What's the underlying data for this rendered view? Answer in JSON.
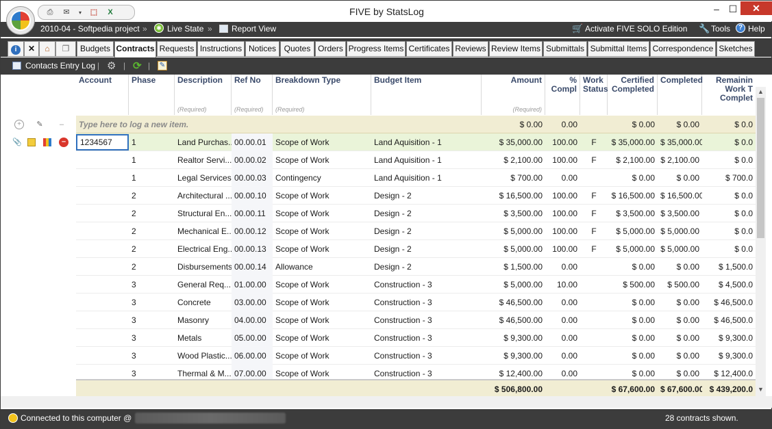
{
  "window": {
    "title": "FIVE by StatsLog",
    "minimize": "–",
    "maximize": "☐",
    "close": "✕"
  },
  "quick_access": [
    "printer-icon",
    "email-icon",
    "dropdown-icon",
    "pdf-icon",
    "excel-icon"
  ],
  "menu": {
    "project": "2010-04 - Softpedia project",
    "sep": "»",
    "live_state": "Live State",
    "report_view": "Report View",
    "activate": "Activate FIVE SOLO Edition",
    "tools": "Tools",
    "help": "Help"
  },
  "tabs": [
    "Budgets",
    "Contracts",
    "Requests",
    "Instructions",
    "Notices",
    "Quotes",
    "Orders",
    "Progress Items",
    "Certificates",
    "Reviews",
    "Review Items",
    "Submittals",
    "Submittal Items",
    "Correspondence",
    "Sketches"
  ],
  "active_tab": "Contracts",
  "toolbar": {
    "contacts_label": "Contacts Entry Log",
    "sep": "|"
  },
  "columns": {
    "account": "Account",
    "phase": "Phase",
    "description": "Description",
    "ref_no": "Ref No",
    "breakdown": "Breakdown Type",
    "budget_item": "Budget Item",
    "amount": "Amount",
    "pct_l1": "%",
    "pct_l2": "Compl",
    "work_l1": "Work",
    "work_l2": "Status",
    "cert_l1": "Certified",
    "cert_l2": "Completed",
    "completed": "Completed",
    "rem_l1": "Remainin",
    "rem_l2": "Work T",
    "rem_l3": "Complet",
    "required": "(Required)"
  },
  "new_row": {
    "placeholder": "Type here to log a new item.",
    "amount": "$ 0.00",
    "pct": "0.00",
    "certified": "$ 0.00",
    "completed": "$ 0.00",
    "remaining": "$ 0.0"
  },
  "rows": [
    {
      "account": "1234567",
      "phase": "1",
      "description": "Land Purchas...",
      "ref": "00.00.01",
      "breakdown": "Scope of Work",
      "budget": "Land Aquisition - 1",
      "amount": "$ 35,000.00",
      "pct": "100.00",
      "status": "F",
      "certified": "$ 35,000.00",
      "completed": "$ 35,000.00",
      "remaining": "$ 0.0"
    },
    {
      "account": "",
      "phase": "1",
      "description": "Realtor Servi...",
      "ref": "00.00.02",
      "breakdown": "Scope of Work",
      "budget": "Land Aquisition - 1",
      "amount": "$ 2,100.00",
      "pct": "100.00",
      "status": "F",
      "certified": "$ 2,100.00",
      "completed": "$ 2,100.00",
      "remaining": "$ 0.0"
    },
    {
      "account": "",
      "phase": "1",
      "description": "Legal Services",
      "ref": "00.00.03",
      "breakdown": "Contingency",
      "budget": "Land Aquisition - 1",
      "amount": "$ 700.00",
      "pct": "0.00",
      "status": "",
      "certified": "$ 0.00",
      "completed": "$ 0.00",
      "remaining": "$ 700.0"
    },
    {
      "account": "",
      "phase": "2",
      "description": "Architectural ...",
      "ref": "00.00.10",
      "breakdown": "Scope of Work",
      "budget": "Design - 2",
      "amount": "$ 16,500.00",
      "pct": "100.00",
      "status": "F",
      "certified": "$ 16,500.00",
      "completed": "$ 16,500.00",
      "remaining": "$ 0.0"
    },
    {
      "account": "",
      "phase": "2",
      "description": "Structural En...",
      "ref": "00.00.11",
      "breakdown": "Scope of Work",
      "budget": "Design - 2",
      "amount": "$ 3,500.00",
      "pct": "100.00",
      "status": "F",
      "certified": "$ 3,500.00",
      "completed": "$ 3,500.00",
      "remaining": "$ 0.0"
    },
    {
      "account": "",
      "phase": "2",
      "description": "Mechanical E...",
      "ref": "00.00.12",
      "breakdown": "Scope of Work",
      "budget": "Design - 2",
      "amount": "$ 5,000.00",
      "pct": "100.00",
      "status": "F",
      "certified": "$ 5,000.00",
      "completed": "$ 5,000.00",
      "remaining": "$ 0.0"
    },
    {
      "account": "",
      "phase": "2",
      "description": "Electrical Eng...",
      "ref": "00.00.13",
      "breakdown": "Scope of Work",
      "budget": "Design - 2",
      "amount": "$ 5,000.00",
      "pct": "100.00",
      "status": "F",
      "certified": "$ 5,000.00",
      "completed": "$ 5,000.00",
      "remaining": "$ 0.0"
    },
    {
      "account": "",
      "phase": "2",
      "description": "Disbursements",
      "ref": "00.00.14",
      "breakdown": "Allowance",
      "budget": "Design - 2",
      "amount": "$ 1,500.00",
      "pct": "0.00",
      "status": "",
      "certified": "$ 0.00",
      "completed": "$ 0.00",
      "remaining": "$ 1,500.0"
    },
    {
      "account": "",
      "phase": "3",
      "description": "General Req...",
      "ref": "01.00.00",
      "breakdown": "Scope of Work",
      "budget": "Construction - 3",
      "amount": "$ 5,000.00",
      "pct": "10.00",
      "status": "",
      "certified": "$ 500.00",
      "completed": "$ 500.00",
      "remaining": "$ 4,500.0"
    },
    {
      "account": "",
      "phase": "3",
      "description": "Concrete",
      "ref": "03.00.00",
      "breakdown": "Scope of Work",
      "budget": "Construction - 3",
      "amount": "$ 46,500.00",
      "pct": "0.00",
      "status": "",
      "certified": "$ 0.00",
      "completed": "$ 0.00",
      "remaining": "$ 46,500.0"
    },
    {
      "account": "",
      "phase": "3",
      "description": "Masonry",
      "ref": "04.00.00",
      "breakdown": "Scope of Work",
      "budget": "Construction - 3",
      "amount": "$ 46,500.00",
      "pct": "0.00",
      "status": "",
      "certified": "$ 0.00",
      "completed": "$ 0.00",
      "remaining": "$ 46,500.0"
    },
    {
      "account": "",
      "phase": "3",
      "description": "Metals",
      "ref": "05.00.00",
      "breakdown": "Scope of Work",
      "budget": "Construction - 3",
      "amount": "$ 9,300.00",
      "pct": "0.00",
      "status": "",
      "certified": "$ 0.00",
      "completed": "$ 0.00",
      "remaining": "$ 9,300.0"
    },
    {
      "account": "",
      "phase": "3",
      "description": "Wood Plastic...",
      "ref": "06.00.00",
      "breakdown": "Scope of Work",
      "budget": "Construction - 3",
      "amount": "$ 9,300.00",
      "pct": "0.00",
      "status": "",
      "certified": "$ 0.00",
      "completed": "$ 0.00",
      "remaining": "$ 9,300.0"
    },
    {
      "account": "",
      "phase": "3",
      "description": "Thermal & M...",
      "ref": "07.00.00",
      "breakdown": "Scope of Work",
      "budget": "Construction - 3",
      "amount": "$ 12,400.00",
      "pct": "0.00",
      "status": "",
      "certified": "$ 0.00",
      "completed": "$ 0.00",
      "remaining": "$ 12,400.0"
    }
  ],
  "totals": {
    "amount": "$ 506,800.00",
    "certified": "$ 67,600.00",
    "completed": "$ 67,600.00",
    "remaining": "$ 439,200.0"
  },
  "status": {
    "connection": "Connected to this computer @",
    "count": "28 contracts shown."
  },
  "colors": {
    "dark_bar": "#3c3c3c",
    "new_row_bg": "#f1edd3",
    "selected_row_bg": "#eaf4d9",
    "totals_bg": "#f1edd3",
    "header_text": "#3a4a6a",
    "close_button": "#c7382b"
  }
}
